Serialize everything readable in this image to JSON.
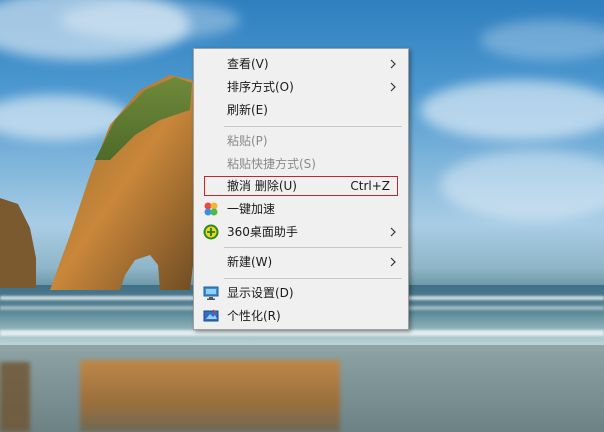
{
  "context_menu": {
    "items": [
      {
        "label": "查看(V)",
        "submenu": true,
        "icon": ""
      },
      {
        "label": "排序方式(O)",
        "submenu": true,
        "icon": ""
      },
      {
        "label": "刷新(E)",
        "submenu": false,
        "icon": ""
      },
      {
        "label": "粘贴(P)",
        "disabled": true,
        "icon": ""
      },
      {
        "label": "粘贴快捷方式(S)",
        "disabled": true,
        "icon": ""
      },
      {
        "label": "撤消 删除(U)",
        "shortcut": "Ctrl+Z",
        "highlighted": true,
        "icon": ""
      },
      {
        "label": "一键加速",
        "submenu": false,
        "icon": "speedup-icon"
      },
      {
        "label": "360桌面助手",
        "submenu": true,
        "icon": "360-assistant-icon"
      },
      {
        "label": "新建(W)",
        "submenu": true,
        "icon": ""
      },
      {
        "label": "显示设置(D)",
        "submenu": false,
        "icon": "display-settings-icon"
      },
      {
        "label": "个性化(R)",
        "submenu": false,
        "icon": "personalize-icon"
      }
    ]
  },
  "colors": {
    "menu_bg": "#f0f0f0",
    "highlight_border": "#c0282d",
    "disabled_text": "#8a8a8a"
  }
}
